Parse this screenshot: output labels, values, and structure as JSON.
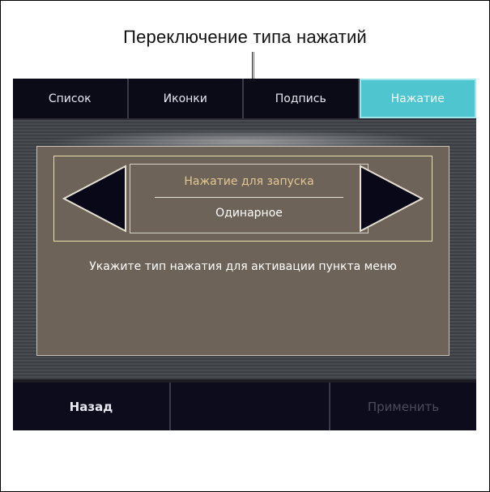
{
  "callout": {
    "text": "Переключение типа нажатий"
  },
  "tabs": [
    {
      "label": "Список",
      "active": false
    },
    {
      "label": "Иконки",
      "active": false
    },
    {
      "label": "Подпись",
      "active": false
    },
    {
      "label": "Нажатие",
      "active": true
    }
  ],
  "selector": {
    "label": "Нажатие для запуска",
    "value": "Одинарное",
    "prev_icon": "arrow-left-icon",
    "next_icon": "arrow-right-icon"
  },
  "hint": {
    "text": "Укажите тип нажатия для активации пункта меню"
  },
  "bottom": {
    "back_label": "Назад",
    "empty_label": "",
    "apply_label": "Применить"
  },
  "colors": {
    "active_tab": "#4fc6cf",
    "panel": "#6d6359",
    "bar": "#0b0b16",
    "label_gold": "#e2c792"
  }
}
